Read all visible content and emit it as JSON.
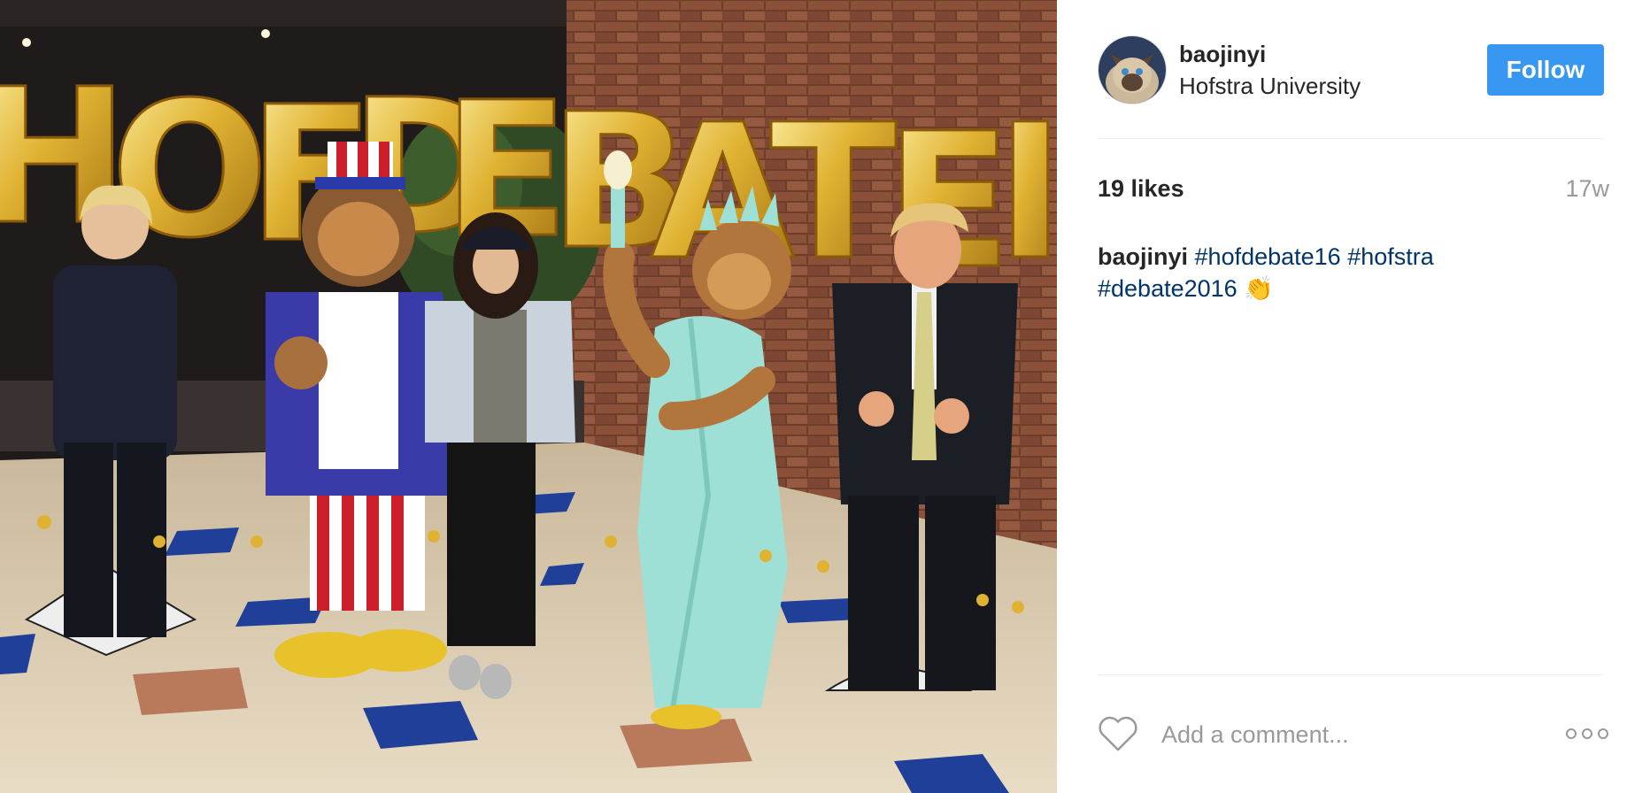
{
  "post": {
    "username": "baojinyi",
    "location": "Hofstra University",
    "follow_label": "Follow",
    "likes": "19 likes",
    "time_ago": "17w",
    "caption": {
      "user": "baojinyi",
      "tag1": "#hofdebate16",
      "tag2": "#hofstra",
      "tag3": "#debate2016",
      "emoji": "👏"
    },
    "comment_placeholder": "Add a comment..."
  },
  "photo": {
    "balloon_text": "HOFDEBATE"
  },
  "icons": {
    "like": "heart-icon",
    "more": "more-options-icon",
    "avatar": "cat-avatar"
  },
  "colors": {
    "follow_button": "#3897f0",
    "hashtag": "#003569",
    "muted": "#999999",
    "text": "#262626"
  }
}
